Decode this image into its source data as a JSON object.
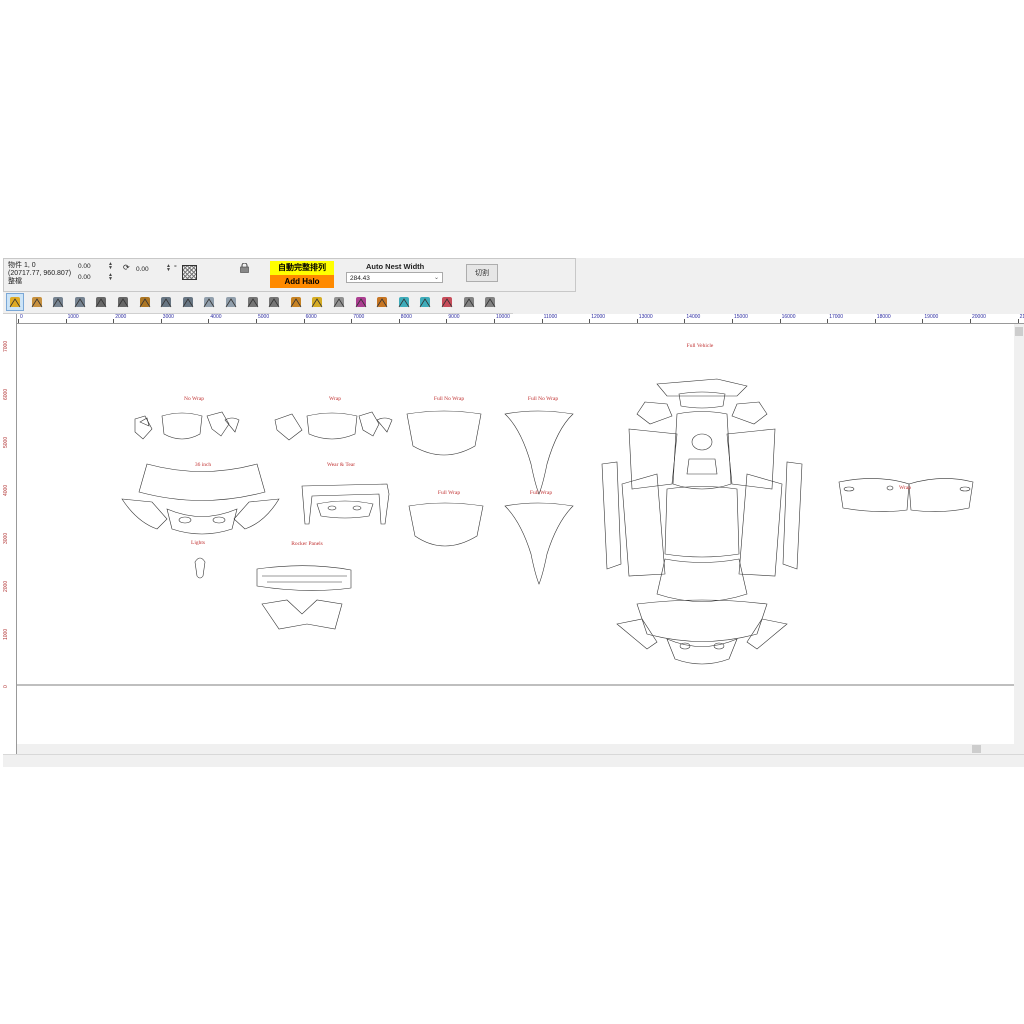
{
  "properties": {
    "line1": "物件 1, 0",
    "line2": "(20717.77, 960.807)",
    "line3": "整檔",
    "x_value": "0.00",
    "y_value": "0.00",
    "rotation": "0.00",
    "angle_unit": "°",
    "auto_button_top": "自動完整排列",
    "auto_button_bottom": "Add Halo",
    "nest_label": "Auto Nest Width",
    "nest_value": "284.43",
    "cut_button": "切割"
  },
  "toolbar": {
    "tools": [
      "select-tool-icon",
      "open-file-icon",
      "undo-icon",
      "redo-icon",
      "mirror-icon",
      "weld-icon",
      "zoom-icon",
      "node-edit-icon",
      "node-delete-icon",
      "break-node-icon",
      "smooth-node-icon",
      "fill-icon",
      "group-icon",
      "text-icon",
      "pen-icon",
      "align-icon",
      "color-icon",
      "text-style-icon",
      "layer-icon",
      "layer-edit-icon",
      "layer-color-icon",
      "lock-icon",
      "unlock-icon"
    ]
  },
  "ruler": {
    "h_ticks": [
      "0",
      "1000",
      "2000",
      "3000",
      "4000",
      "5000",
      "6000",
      "7000",
      "8000",
      "9000",
      "10000",
      "11000",
      "12000",
      "13000",
      "14000",
      "15000",
      "16000",
      "17000",
      "18000",
      "19000",
      "20000",
      "21"
    ],
    "v_ticks": [
      "7000",
      "6000",
      "5000",
      "4000",
      "3000",
      "2000",
      "1000",
      "0"
    ]
  },
  "canvas": {
    "labels": {
      "no_wrap": "No Wrap",
      "wrap_1": "Wrap",
      "full_no_wrap_1": "Full No Wrap",
      "full_no_wrap_2": "Full No Wrap",
      "inch_36": "36 inch",
      "wear_tear": "Wear & Tear",
      "full_wrap_1": "Full Wrap",
      "full_wrap_2": "Full Wrap",
      "lights": "Lights",
      "rocker_panels": "Rocker Panels",
      "full_vehicle": "Full Vehicle",
      "wrap_2": "Wrap"
    }
  },
  "colors": {
    "accent_yellow": "#ffff00",
    "accent_orange": "#ff8a00",
    "label_red": "#c03030",
    "ruler_blue": "#2a2aa0"
  }
}
